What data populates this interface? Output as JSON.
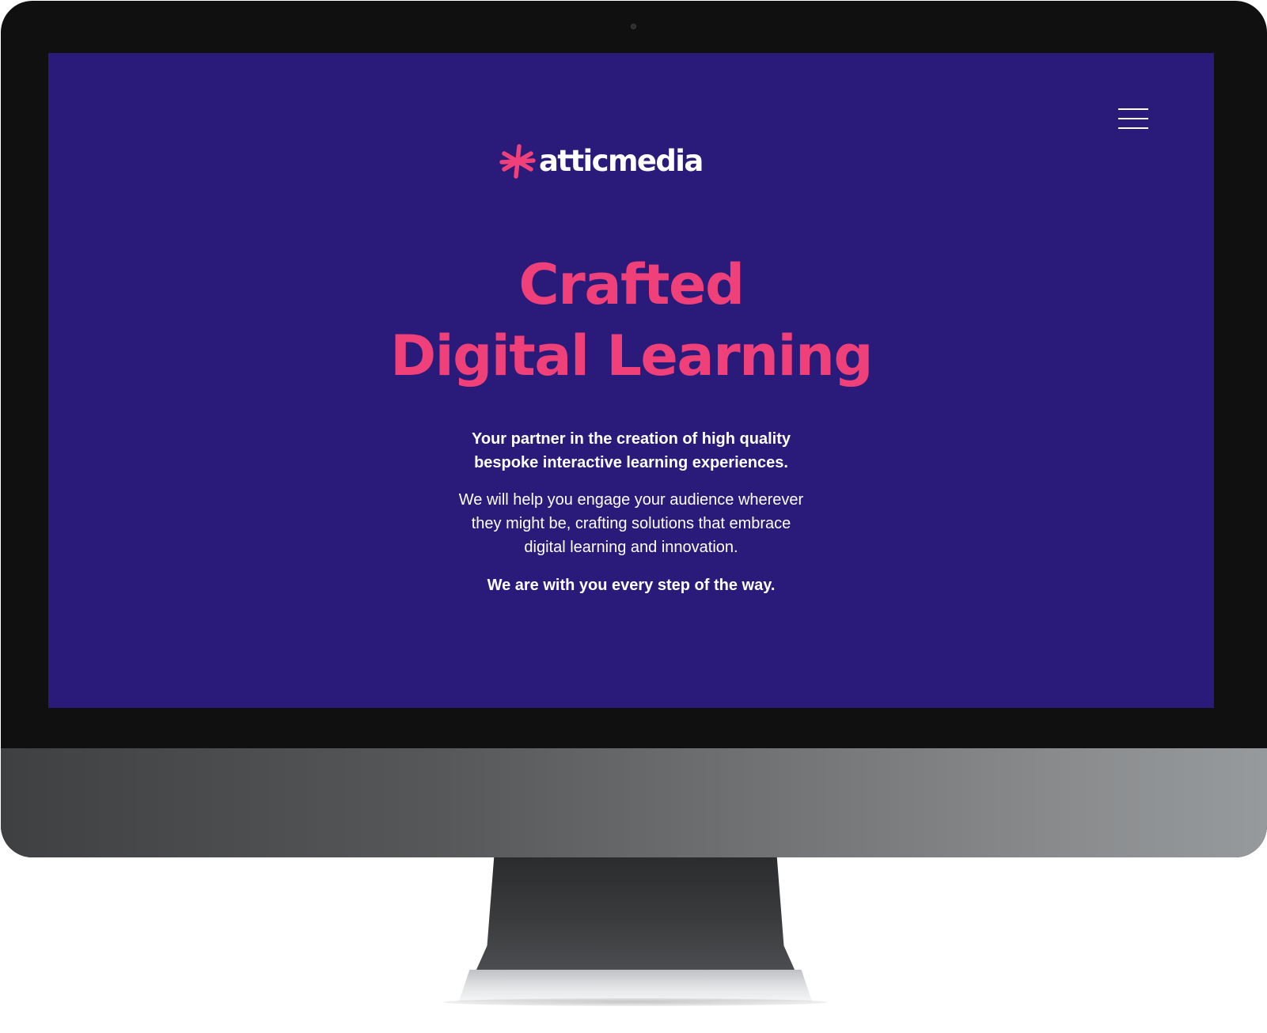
{
  "brand": {
    "name": "atticmedia",
    "accent_color": "#f0407a",
    "background_color": "#2a1b7a",
    "logo_icon": "asterisk-burst-icon"
  },
  "header": {
    "menu_icon": "hamburger-menu-icon"
  },
  "hero": {
    "title_lines": [
      "Crafted",
      "Digital Learning"
    ],
    "tagline_lines": [
      "Your partner in the creation of high quality",
      "bespoke interactive learning experiences."
    ],
    "body_lines": [
      "We will help you engage your audience wherever",
      "they might be, crafting solutions that embrace",
      "digital learning and innovation."
    ],
    "closing": "We are with you every step of the way."
  }
}
